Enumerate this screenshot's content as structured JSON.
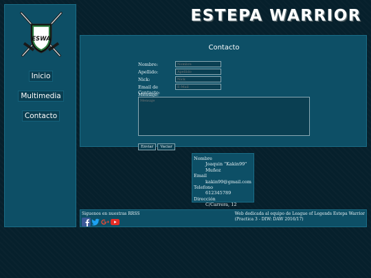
{
  "brand": {
    "title": "ESTEPA WARRIOR",
    "logo_text": "ESWA"
  },
  "nav": {
    "items": [
      "Inicio",
      "Multimedia",
      "Contacto"
    ]
  },
  "form": {
    "title": "Contacto",
    "fields": [
      {
        "label": "Nombre:",
        "placeholder": "Nombre"
      },
      {
        "label": "Apellido:",
        "placeholder": "Apellido"
      },
      {
        "label": "Nick:",
        "placeholder": "Nick"
      },
      {
        "label": "Email de Contacto:",
        "placeholder": "E-Mail"
      }
    ],
    "message_label": "Mensaje:",
    "message_placeholder": "Mensaje",
    "submit_label": "Enviar",
    "reset_label": "Vaciar"
  },
  "contact_card": {
    "name_label": "Nombre",
    "name_value": "Joaquin \"Kakin99\" Muñoz",
    "email_label": "Email",
    "email_value": "kakin99@gmail.com",
    "phone_label": "Telefono",
    "phone_value": "612345789",
    "address_label": "Dirección",
    "address_value": "C/Carrera, 12"
  },
  "footer": {
    "follow_text": "Siguenos en nuestras RRSS",
    "social_icons": [
      "facebook-icon",
      "twitter-icon",
      "google-plus-icon",
      "youtube-icon"
    ],
    "credit_line1": "Web dedicada al equipo de League of Legends Estepa Warrior",
    "credit_line2": "(Practica 3 - DIW: DAW 2016/17)"
  },
  "colors": {
    "background": "#06202c",
    "panel": "#0d4f66",
    "facebook": "#3b5998",
    "twitter": "#1da1f2",
    "google_plus": "#dd4b39",
    "youtube": "#e52d27"
  }
}
